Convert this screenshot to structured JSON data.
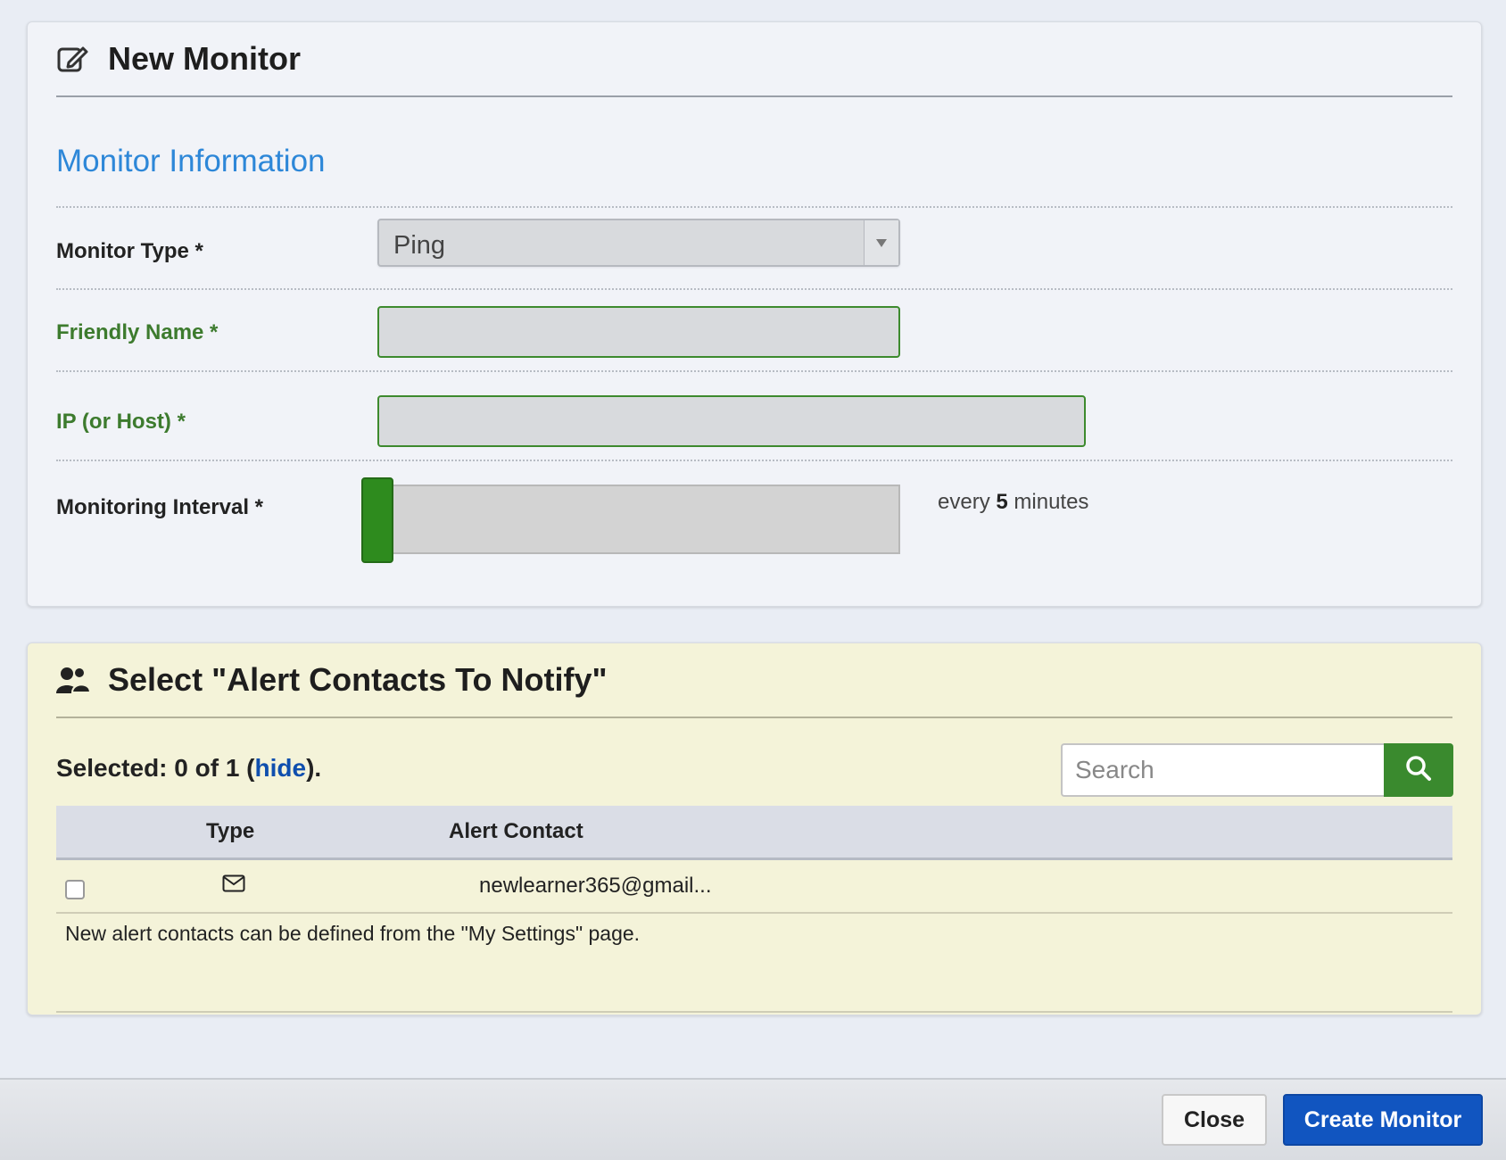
{
  "monitor_panel": {
    "title": "New Monitor",
    "section_title": "Monitor Information",
    "monitor_type": {
      "label": "Monitor Type *",
      "value": "Ping"
    },
    "friendly_name": {
      "label": "Friendly Name *",
      "value": ""
    },
    "host": {
      "label": "IP (or Host) *",
      "value": ""
    },
    "interval": {
      "label": "Monitoring Interval *",
      "prefix": "every",
      "value": "5",
      "suffix": "minutes",
      "slider_level": 0
    }
  },
  "alerts_panel": {
    "title": "Select \"Alert Contacts To Notify\"",
    "selected_prefix": "Selected: 0 of 1 (",
    "hide_link": "hide",
    "selected_suffix": ").",
    "search": {
      "placeholder": "Search"
    },
    "columns": [
      "",
      "Type",
      "Alert Contact"
    ],
    "rows": [
      {
        "checked": false,
        "type_icon": "envelope-icon",
        "contact": "newlearner365@gmail..."
      }
    ],
    "note": "New alert contacts can be defined from the \"My Settings\" page."
  },
  "footer": {
    "close_label": "Close",
    "create_label": "Create Monitor"
  },
  "colors": {
    "accent_blue": "#1155c0",
    "accent_green": "#3a8a2e",
    "section_title": "#2d87d8"
  }
}
